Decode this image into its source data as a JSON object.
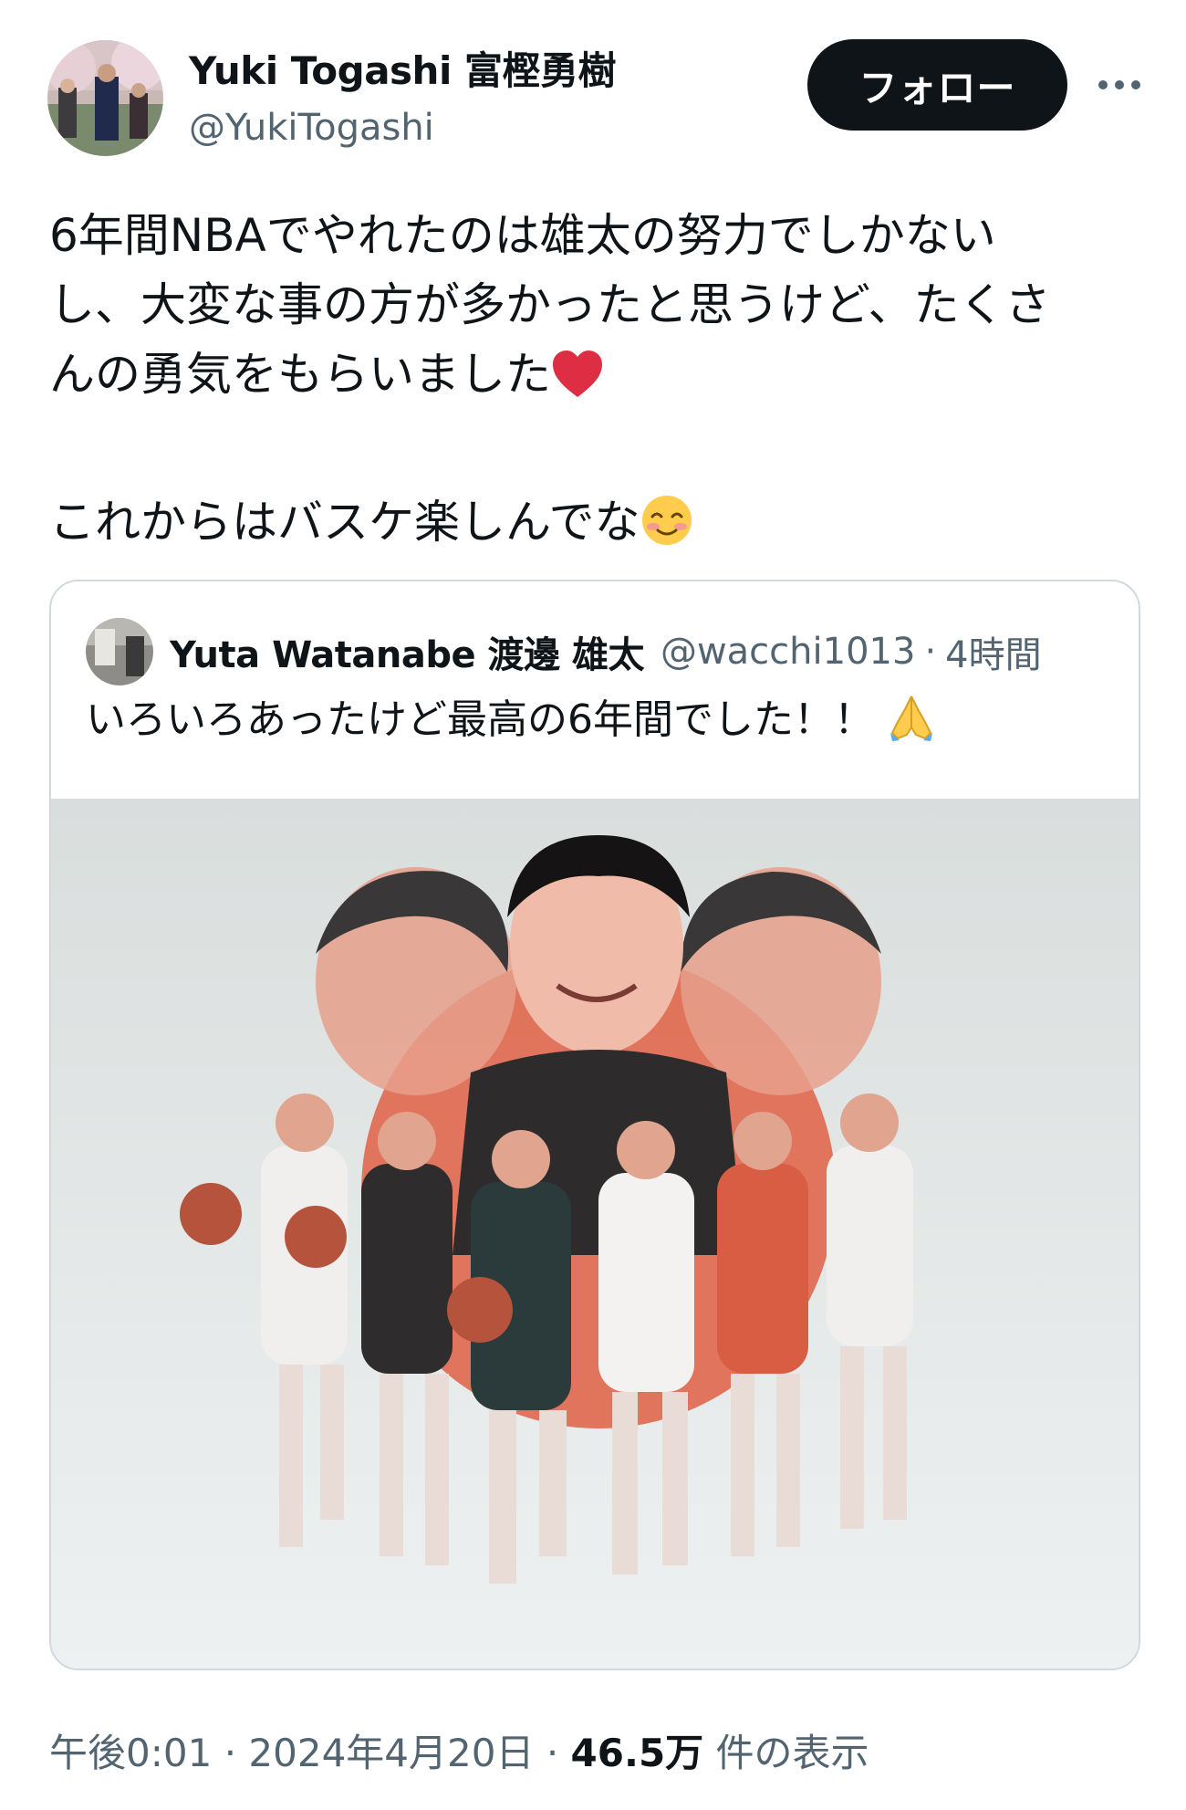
{
  "author": {
    "display_name": "Yuki Togashi 富樫勇樹",
    "handle": "@YukiTogashi"
  },
  "follow_label": "フォロー",
  "tweet": {
    "text_line1": "6年間NBAでやれたのは雄太の努力でしかない",
    "text_line2": "し、大変な事の方が多かったと思うけど、たくさ",
    "text_line3": "んの勇気をもらいました",
    "text_line4": "これからはバスケ楽しんでな"
  },
  "quoted": {
    "display_name": "Yuta Watanabe 渡邊 雄太",
    "handle": "@wacchi1013",
    "separator": "·",
    "time": "4時間",
    "text": "いろいろあったけど最高の6年間でした！！"
  },
  "meta": {
    "time": "午後0:01",
    "sep": "·",
    "date": "2024年4月20日",
    "views": "46.5万",
    "views_label": "件の表示"
  },
  "colors": {
    "text": "#0f1419",
    "secondary": "#536471",
    "border": "#cfd9de",
    "follow_bg": "#0f1419"
  },
  "icons": [
    "heart-emoji-icon",
    "smiling-face-emoji-icon",
    "folded-hands-emoji-icon",
    "more-icon"
  ]
}
